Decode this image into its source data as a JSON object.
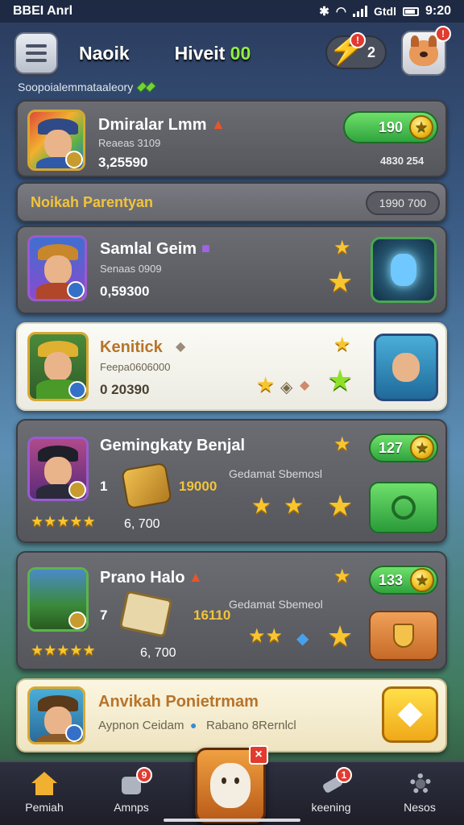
{
  "status_bar": {
    "left_text": "BBEI Anrl",
    "time": "9:20",
    "right_label": "Gtdl"
  },
  "header": {
    "player_name": "Naoik",
    "level_label": "Hiveit",
    "level_value": "00",
    "notifications_count": "2",
    "notif_badge": "!",
    "avatar_badge": "!"
  },
  "section_label": "Soopoialemmataaleory",
  "cards": [
    {
      "title": "Dmiralar Lmm",
      "subtitle": "Reaeas 3109",
      "value": "3,25590",
      "pill_value": "190",
      "side_text": "4830 254"
    },
    {
      "title": "Noikah Parentyan",
      "pill_text": "1990 700"
    },
    {
      "title": "Samlal Geim",
      "subtitle": "Senaas 0909",
      "value": "0,59300"
    },
    {
      "title": "Kenitick",
      "subtitle": "Feepa0606000",
      "value": "0 20390"
    },
    {
      "title": "Gemingkaty Benjal",
      "number": "1",
      "item_value": "19000",
      "right_text": "Gedamat Sbemosl",
      "pill_value": "127",
      "footer_value": "6, 700"
    },
    {
      "title": "Prano Halo",
      "number": "7",
      "item_value": "16110",
      "right_text": "Gedamat Sbemeol",
      "pill_value": "133",
      "footer_value": "6, 700"
    },
    {
      "title": "Anvikah Ponietrmam",
      "subtitle_a": "Aypnon Ceidam",
      "subtitle_b": "Rabano 8Rernlcl"
    }
  ],
  "bottom_nav": [
    {
      "label": "Pemiah",
      "icon": "home-icon"
    },
    {
      "label": "Amnps",
      "icon": "bag-icon",
      "badge": "9"
    },
    {
      "label": "",
      "icon": "mascot-icon",
      "badge": "×"
    },
    {
      "label": "keening",
      "icon": "hammer-icon",
      "badge": "1"
    },
    {
      "label": "Nesos",
      "icon": "gear-icon"
    }
  ],
  "colors": {
    "accent_green": "#2fa43d",
    "gold": "#f0c020",
    "alert_red": "#e23a2f"
  }
}
